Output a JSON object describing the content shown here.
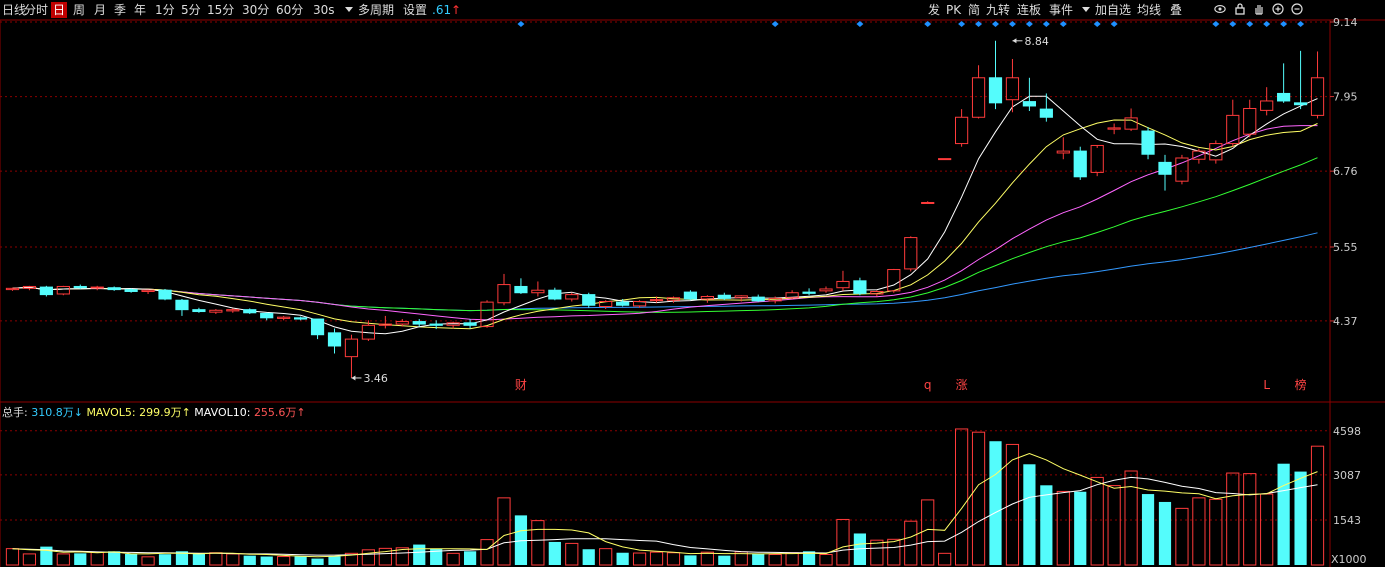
{
  "toolbar": {
    "items": [
      "日线",
      "分时",
      "日",
      "周",
      "月",
      "季",
      "年",
      "1分",
      "5分",
      "15分",
      "30分",
      "60分",
      "30s",
      "多周期",
      "设置",
      ".61"
    ],
    "active_index": 2,
    "right_items": [
      "发",
      "PK",
      "简",
      "九转",
      "连板",
      "事件",
      "加自选",
      "均线",
      "叠"
    ]
  },
  "icons": [
    "eye-icon",
    "lock-icon",
    "hand-icon",
    "zoom-in-icon",
    "zoom-out-icon"
  ],
  "colors": {
    "up": "#ff3b3b",
    "down": "#54fcfc",
    "grid": "#8b0000",
    "axis_text": "#cccccc",
    "ma5": "#ffffff",
    "ma10": "#ffff66",
    "ma20": "#ff66ff",
    "ma30": "#33ff33",
    "ma60": "#3399ff",
    "marker": "#1e90ff"
  },
  "chart_data": [
    {
      "type": "candlestick",
      "y_ticks": [
        "9.14",
        "7.95",
        "6.76",
        "5.55",
        "4.37"
      ],
      "ylim": [
        3.22,
        9.14
      ],
      "annotations": [
        {
          "text": "8.84",
          "value": 8.84,
          "index": 59
        },
        {
          "text": "3.46",
          "value": 3.46,
          "index": 20
        }
      ],
      "event_labels": [
        {
          "text": "财",
          "index": 30
        },
        {
          "text": "q",
          "index": 54
        },
        {
          "text": "涨",
          "index": 56
        },
        {
          "text": "L",
          "index": 74
        },
        {
          "text": "榜",
          "index": 76
        }
      ],
      "event_markers": [
        30,
        45,
        50,
        54,
        56,
        57,
        58,
        59,
        60,
        61,
        62,
        64,
        65,
        71,
        72,
        73,
        74,
        75,
        76
      ],
      "candles": [
        [
          4.87,
          4.9,
          4.85,
          4.89
        ],
        [
          4.89,
          4.93,
          4.86,
          4.92
        ],
        [
          4.91,
          4.93,
          4.76,
          4.79
        ],
        [
          4.8,
          4.93,
          4.78,
          4.92
        ],
        [
          4.92,
          4.95,
          4.88,
          4.9
        ],
        [
          4.9,
          4.93,
          4.86,
          4.91
        ],
        [
          4.9,
          4.92,
          4.85,
          4.87
        ],
        [
          4.87,
          4.89,
          4.82,
          4.84
        ],
        [
          4.84,
          4.87,
          4.8,
          4.86
        ],
        [
          4.86,
          4.88,
          4.7,
          4.72
        ],
        [
          4.7,
          4.72,
          4.45,
          4.55
        ],
        [
          4.55,
          4.58,
          4.5,
          4.52
        ],
        [
          4.51,
          4.56,
          4.48,
          4.54
        ],
        [
          4.53,
          4.57,
          4.5,
          4.55
        ],
        [
          4.55,
          4.57,
          4.48,
          4.5
        ],
        [
          4.49,
          4.5,
          4.38,
          4.42
        ],
        [
          4.41,
          4.45,
          4.38,
          4.43
        ],
        [
          4.42,
          4.44,
          4.38,
          4.4
        ],
        [
          4.4,
          4.4,
          4.08,
          4.15
        ],
        [
          4.18,
          4.25,
          3.85,
          3.97
        ],
        [
          3.8,
          4.15,
          3.46,
          4.08
        ],
        [
          4.08,
          4.38,
          4.05,
          4.3
        ],
        [
          4.3,
          4.45,
          4.25,
          4.32
        ],
        [
          4.32,
          4.4,
          4.28,
          4.36
        ],
        [
          4.36,
          4.4,
          4.28,
          4.32
        ],
        [
          4.32,
          4.38,
          4.24,
          4.3
        ],
        [
          4.3,
          4.36,
          4.25,
          4.34
        ],
        [
          4.34,
          4.4,
          4.25,
          4.3
        ],
        [
          4.28,
          4.7,
          4.26,
          4.67
        ],
        [
          4.66,
          5.12,
          4.62,
          4.95
        ],
        [
          4.92,
          5.05,
          4.8,
          4.82
        ],
        [
          4.82,
          5.0,
          4.76,
          4.86
        ],
        [
          4.86,
          4.9,
          4.7,
          4.72
        ],
        [
          4.72,
          4.82,
          4.68,
          4.79
        ],
        [
          4.79,
          4.82,
          4.58,
          4.62
        ],
        [
          4.6,
          4.7,
          4.56,
          4.68
        ],
        [
          4.67,
          4.72,
          4.6,
          4.62
        ],
        [
          4.61,
          4.7,
          4.58,
          4.68
        ],
        [
          4.7,
          4.76,
          4.66,
          4.71
        ],
        [
          4.7,
          4.76,
          4.66,
          4.74
        ],
        [
          4.83,
          4.86,
          4.7,
          4.72
        ],
        [
          4.72,
          4.78,
          4.66,
          4.76
        ],
        [
          4.78,
          4.82,
          4.7,
          4.73
        ],
        [
          4.74,
          4.78,
          4.68,
          4.77
        ],
        [
          4.75,
          4.79,
          4.67,
          4.69
        ],
        [
          4.69,
          4.76,
          4.65,
          4.73
        ],
        [
          4.74,
          4.86,
          4.72,
          4.82
        ],
        [
          4.83,
          4.89,
          4.78,
          4.81
        ],
        [
          4.85,
          4.92,
          4.82,
          4.88
        ],
        [
          4.9,
          5.17,
          4.85,
          5.0
        ],
        [
          5.01,
          5.06,
          4.78,
          4.81
        ],
        [
          4.8,
          4.86,
          4.76,
          4.84
        ],
        [
          4.85,
          5.2,
          4.82,
          5.19
        ],
        [
          5.2,
          5.72,
          5.16,
          5.7
        ],
        [
          6.25,
          6.28,
          6.25,
          6.26
        ],
        [
          6.95,
          6.95,
          6.95,
          6.96
        ],
        [
          7.2,
          7.75,
          7.15,
          7.62
        ],
        [
          7.62,
          8.45,
          7.6,
          8.25
        ],
        [
          8.25,
          8.84,
          7.75,
          7.85
        ],
        [
          7.9,
          8.55,
          7.7,
          8.25
        ],
        [
          7.87,
          8.25,
          7.72,
          7.8
        ],
        [
          7.75,
          8.0,
          7.55,
          7.62
        ],
        [
          7.05,
          7.3,
          6.95,
          7.08
        ],
        [
          7.08,
          7.15,
          6.62,
          6.67
        ],
        [
          6.74,
          7.13,
          6.68,
          7.17
        ],
        [
          7.43,
          7.52,
          7.35,
          7.45
        ],
        [
          7.43,
          7.76,
          7.4,
          7.61
        ],
        [
          7.4,
          7.46,
          6.95,
          7.03
        ],
        [
          6.9,
          7.02,
          6.45,
          6.71
        ],
        [
          6.6,
          7.02,
          6.55,
          6.97
        ],
        [
          6.95,
          7.12,
          6.88,
          7.08
        ],
        [
          6.94,
          7.25,
          6.88,
          7.2
        ],
        [
          7.2,
          7.9,
          7.15,
          7.65
        ],
        [
          7.35,
          7.9,
          7.3,
          7.76
        ],
        [
          7.73,
          8.1,
          7.65,
          7.88
        ],
        [
          8.0,
          8.48,
          7.85,
          7.88
        ],
        [
          7.85,
          8.68,
          7.75,
          7.82
        ],
        [
          7.65,
          8.67,
          7.6,
          8.25
        ]
      ]
    },
    {
      "type": "bar",
      "title": "总手",
      "unit": "X1000",
      "y_ticks": [
        "4598",
        "3087",
        "1543"
      ],
      "ylim": [
        0,
        4830
      ],
      "legend": [
        {
          "label": "总手:",
          "value": "310.8万↓"
        },
        {
          "label": "MAVOL5:",
          "value": "299.9万↑"
        },
        {
          "label": "MAVOL10:",
          "value": "255.6万↑"
        }
      ],
      "values": [
        560,
        380,
        630,
        380,
        400,
        430,
        470,
        380,
        280,
        370,
        470,
        400,
        420,
        380,
        320,
        290,
        290,
        290,
        220,
        300,
        400,
        520,
        570,
        590,
        700,
        550,
        400,
        470,
        870,
        2300,
        1700,
        1520,
        790,
        740,
        540,
        560,
        420,
        410,
        440,
        420,
        330,
        440,
        320,
        450,
        390,
        360,
        420,
        470,
        360,
        1560,
        1080,
        850,
        880,
        1500,
        2230,
        400,
        4660,
        4550,
        4240,
        4130,
        3450,
        2730,
        2520,
        2510,
        3000,
        2720,
        3220,
        2430,
        2160,
        1940,
        2300,
        2250,
        3150,
        3130,
        2430,
        3470,
        3200,
        4070
      ],
      "mavol5": [
        560,
        520,
        500,
        440,
        450,
        420,
        450,
        380,
        380,
        400,
        400,
        380,
        410,
        400,
        370,
        360,
        330,
        300,
        280,
        300,
        340,
        400,
        460,
        530,
        560,
        560,
        560,
        550,
        530,
        1010,
        1170,
        1220,
        1220,
        1200,
        1100,
        800,
        620,
        510,
        470,
        440,
        390,
        400,
        390,
        390,
        380,
        390,
        390,
        400,
        390,
        620,
        720,
        750,
        800,
        960,
        1220,
        1190,
        1940,
        2750,
        3100,
        3600,
        3820,
        3600,
        3300,
        3080,
        2850,
        2630,
        2690,
        2570,
        2530,
        2470,
        2440,
        2270,
        2370,
        2420,
        2440,
        2720,
        2970,
        3200
      ],
      "mavol10": [
        560,
        540,
        520,
        480,
        470,
        450,
        440,
        430,
        420,
        420,
        410,
        400,
        400,
        390,
        380,
        380,
        370,
        350,
        340,
        340,
        350,
        370,
        390,
        410,
        440,
        470,
        500,
        510,
        540,
        760,
        830,
        850,
        870,
        900,
        900,
        900,
        870,
        840,
        820,
        700,
        600,
        550,
        500,
        460,
        440,
        430,
        420,
        420,
        410,
        510,
        560,
        580,
        600,
        680,
        800,
        820,
        1120,
        1490,
        1800,
        2090,
        2320,
        2400,
        2480,
        2550,
        2750,
        2900,
        3000,
        2950,
        2830,
        2700,
        2620,
        2480,
        2450,
        2400,
        2450,
        2550,
        2650,
        2750
      ]
    }
  ]
}
